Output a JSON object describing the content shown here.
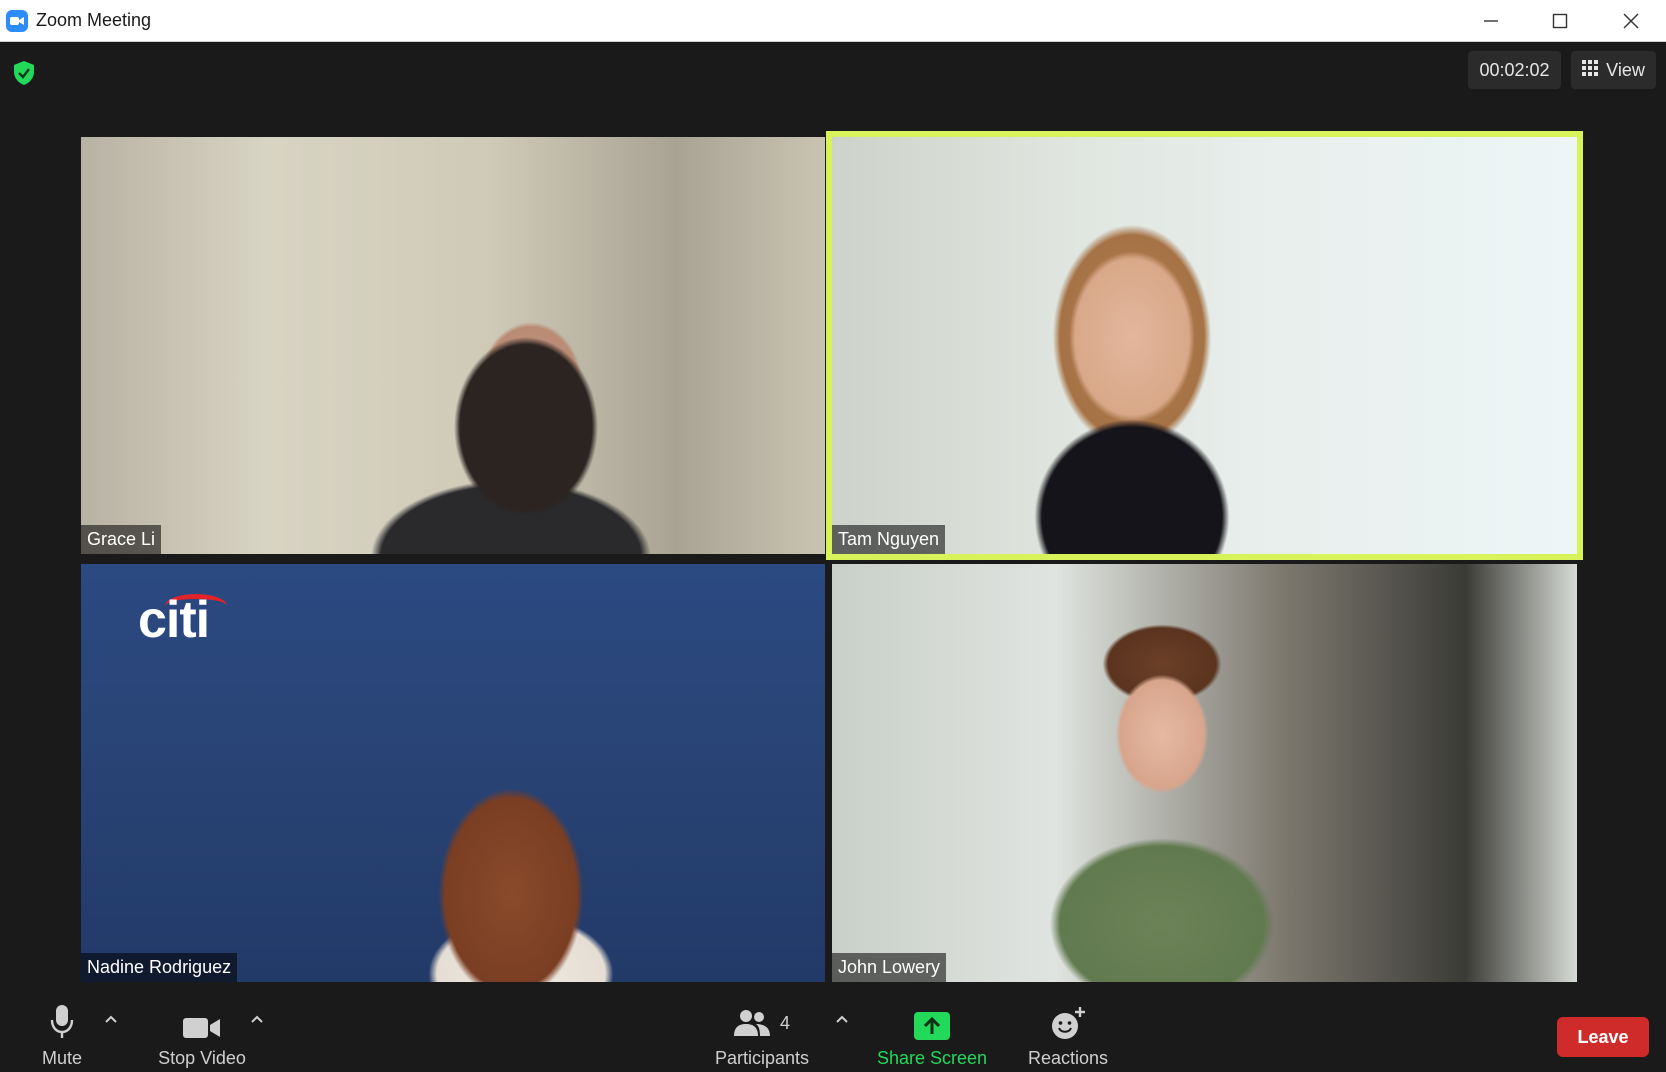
{
  "window": {
    "title": "Zoom Meeting"
  },
  "top_bar": {
    "timer": "00:02:02",
    "view_label": "View"
  },
  "participants": [
    {
      "name": "Grace Li",
      "active_speaker": false
    },
    {
      "name": "Tam Nguyen",
      "active_speaker": true
    },
    {
      "name": "Nadine Rodriguez",
      "active_speaker": false
    },
    {
      "name": "John Lowery",
      "active_speaker": false
    }
  ],
  "tile_logo": "citi",
  "toolbar": {
    "mute_label": "Mute",
    "stop_video_label": "Stop Video",
    "participants_label": "Participants",
    "participants_count": "4",
    "share_screen_label": "Share Screen",
    "reactions_label": "Reactions",
    "leave_label": "Leave"
  },
  "colors": {
    "active_speaker_border": "#d8f25a",
    "share_screen": "#23d959",
    "leave_button": "#d02b2b",
    "shield": "#23d959",
    "zoom_brand": "#2d8cff"
  },
  "icons": [
    "zoom-logo-icon",
    "minimize-icon",
    "maximize-icon",
    "close-icon",
    "shield-check-icon",
    "grid-view-icon",
    "microphone-icon",
    "video-camera-icon",
    "participants-icon",
    "share-screen-icon",
    "reactions-icon",
    "caret-up-icon"
  ]
}
